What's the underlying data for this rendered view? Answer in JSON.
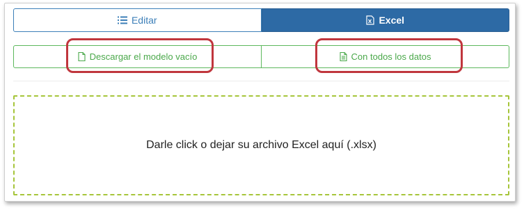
{
  "tabs": [
    {
      "label": "Editar",
      "icon": "list-icon",
      "active": false
    },
    {
      "label": "Excel",
      "icon": "excel-file-icon",
      "active": true
    }
  ],
  "downloads": {
    "empty_template_label": "Descargar el modelo vacío",
    "all_data_label": "Con todos los datos"
  },
  "dropzone": {
    "text": "Darle click o dejar su archivo Excel aquí (.xlsx)"
  },
  "colors": {
    "primary": "#2d6aa5",
    "success": "#5cb85c",
    "dropzone_border": "#a6c53a",
    "highlight": "#c0363d"
  }
}
